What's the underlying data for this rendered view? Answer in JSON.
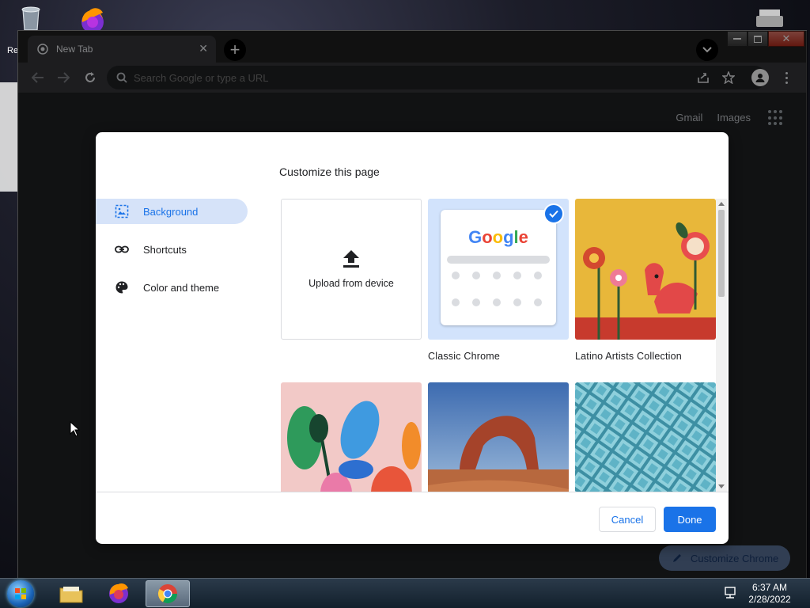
{
  "desktop": {
    "recycle_bin_label": "Re"
  },
  "browser": {
    "tab": {
      "title": "New Tab"
    },
    "omnibox": {
      "placeholder": "Search Google or type a URL"
    },
    "ntp": {
      "links": [
        "Gmail",
        "Images"
      ],
      "customize_label": "Customize Chrome"
    }
  },
  "dialog": {
    "title": "Customize this page",
    "sidebar": [
      {
        "label": "Background",
        "icon": "image-icon",
        "active": true
      },
      {
        "label": "Shortcuts",
        "icon": "link-icon",
        "active": false
      },
      {
        "label": "Color and theme",
        "icon": "palette-icon",
        "active": false
      }
    ],
    "tiles": {
      "upload_label": "Upload from device",
      "classic_label": "Classic Chrome",
      "classic_logo": "Google",
      "latino_label": "Latino Artists Collection"
    },
    "buttons": {
      "cancel": "Cancel",
      "done": "Done"
    }
  },
  "taskbar": {
    "time": "6:37 AM",
    "date": "2/28/2022"
  },
  "colors": {
    "accent": "#1a73e8",
    "active_nav_bg": "#d6e3f9",
    "browser_bg": "#202124",
    "toolbar_bg": "#35363a"
  }
}
